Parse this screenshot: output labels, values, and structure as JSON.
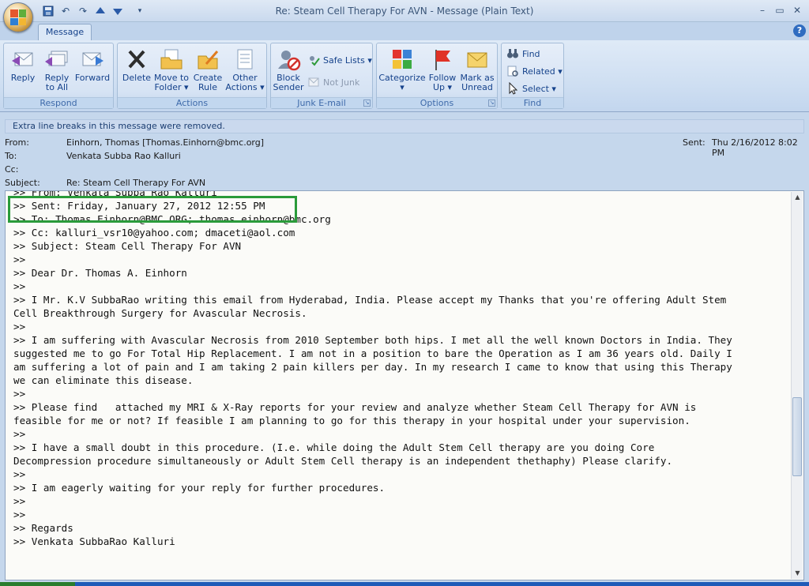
{
  "window": {
    "title": "Re: Steam Cell Therapy For AVN - Message (Plain Text)",
    "controls": [
      "–",
      "▭",
      "✕"
    ]
  },
  "tabs": [
    {
      "label": "Message"
    }
  ],
  "help_label": "?",
  "ribbon": {
    "groups": {
      "respond": "Respond",
      "actions": "Actions",
      "junk": "Junk E-mail",
      "options": "Options",
      "find": "Find"
    },
    "buttons": {
      "reply": [
        "Reply"
      ],
      "reply_all": [
        "Reply",
        "to All"
      ],
      "forward": [
        "Forward"
      ],
      "delete": [
        "Delete"
      ],
      "move_to_folder": [
        "Move to",
        "Folder ▾"
      ],
      "create_rule": [
        "Create",
        "Rule"
      ],
      "other_actions": [
        "Other",
        "Actions ▾"
      ],
      "block_sender": [
        "Block",
        "Sender"
      ],
      "safe_lists": "Safe Lists ▾",
      "not_junk": "Not Junk",
      "categorize": [
        "Categorize",
        "▾"
      ],
      "follow_up": [
        "Follow",
        "Up ▾"
      ],
      "mark_as_unread": [
        "Mark as",
        "Unread"
      ],
      "find": "Find",
      "related": "Related ▾",
      "select": "Select ▾"
    }
  },
  "infobar": "Extra line breaks in this message were removed.",
  "header": {
    "from_label": "From:",
    "from": "Einhorn, Thomas [Thomas.Einhorn@bmc.org]",
    "to_label": "To:",
    "to": "Venkata Subba Rao Kalluri",
    "cc_label": "Cc:",
    "cc": "",
    "subject_label": "Subject:",
    "subject": "Re: Steam Cell Therapy For AVN",
    "sent_label": "Sent:",
    "sent": "Thu 2/16/2012 8:02 PM"
  },
  "body_lines": [
    ">> From: Venkata Subba Rao Kalluri",
    ">> Sent: Friday, January 27, 2012 12:55 PM",
    ">> To: Thomas.Einhorn@BMC.ORG; thomas.einhorn@bmc.org",
    ">> Cc: kalluri_vsr10@yahoo.com; dmaceti@aol.com",
    ">> Subject: Steam Cell Therapy For AVN",
    ">>",
    ">> Dear Dr. Thomas A. Einhorn",
    ">>",
    ">> I Mr. K.V SubbaRao writing this email from Hyderabad, India. Please accept my Thanks that you're offering Adult Stem",
    "Cell Breakthrough Surgery for Avascular Necrosis.",
    ">>",
    ">> I am suffering with Avascular Necrosis from 2010 September both hips. I met all the well known Doctors in India. They",
    "suggested me to go For Total Hip Replacement. I am not in a position to bare the Operation as I am 36 years old. Daily I",
    "am suffering a lot of pain and I am taking 2 pain killers per day. In my research I came to know that using this Therapy",
    "we can eliminate this disease.",
    ">>",
    ">> Please find   attached my MRI & X-Ray reports for your review and analyze whether Steam Cell Therapy for AVN is",
    "feasible for me or not? If feasible I am planning to go for this therapy in your hospital under your supervision.",
    ">>",
    ">> I have a small doubt in this procedure. (I.e. while doing the Adult Stem Cell therapy are you doing Core",
    "Decompression procedure simultaneously or Adult Stem Cell therapy is an independent thethaphy) Please clarify.",
    ">>",
    ">> I am eagerly waiting for your reply for further procedures.",
    ">>",
    ">>",
    ">> Regards",
    ">> Venkata SubbaRao Kalluri"
  ]
}
